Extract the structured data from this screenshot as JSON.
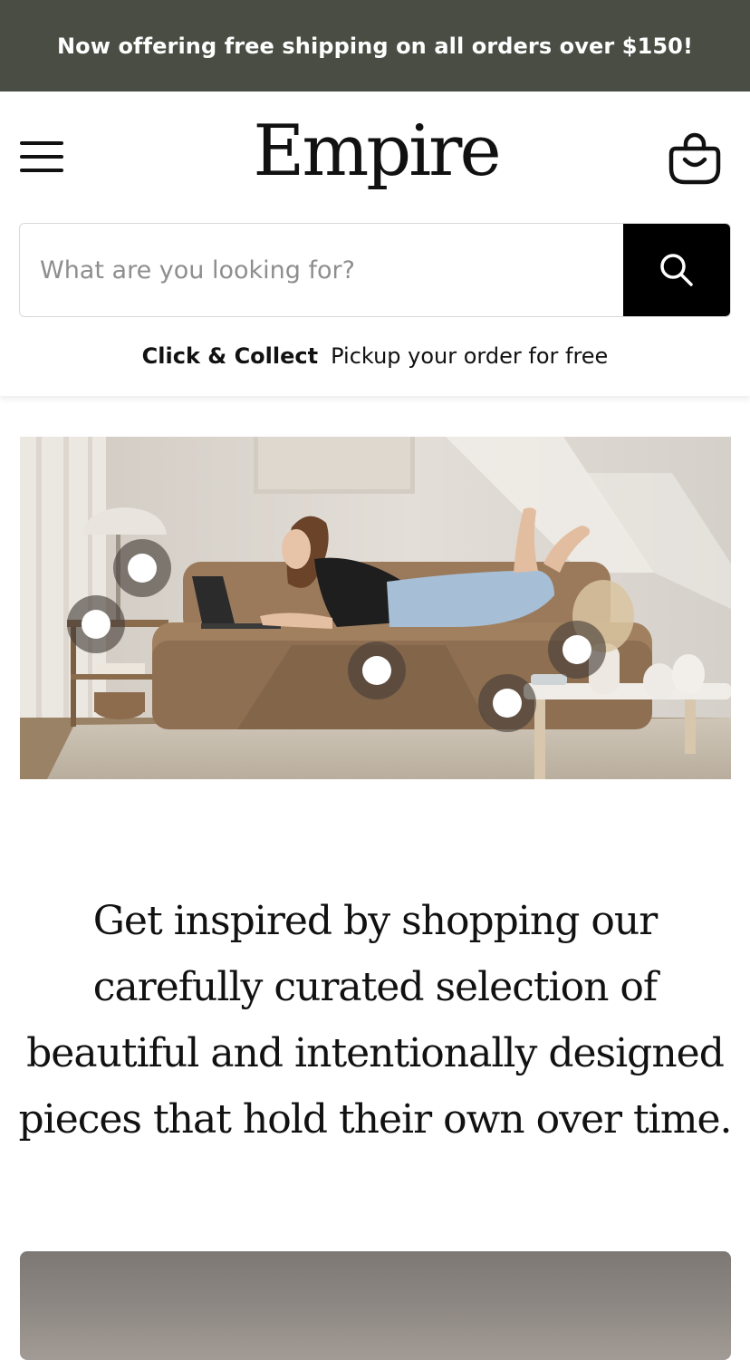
{
  "announcement": {
    "text": "Now offering free shipping on all orders over $150!"
  },
  "header": {
    "logo": "Empire",
    "menu_icon": "hamburger-menu-icon",
    "cart_icon": "shopping-bag-icon"
  },
  "search": {
    "placeholder": "What are you looking for?",
    "value": "",
    "button_icon": "search-icon"
  },
  "click_collect": {
    "title": "Click & Collect",
    "text": "Pickup your order for free"
  },
  "hero": {
    "hotspot_count": 5
  },
  "tagline": "Get inspired by shopping our carefully curated selection of beautiful and intentionally designed pieces that hold their own over time.",
  "colors": {
    "announcement_bg": "#4a4d43",
    "search_button_bg": "#000000",
    "text": "#111111"
  }
}
